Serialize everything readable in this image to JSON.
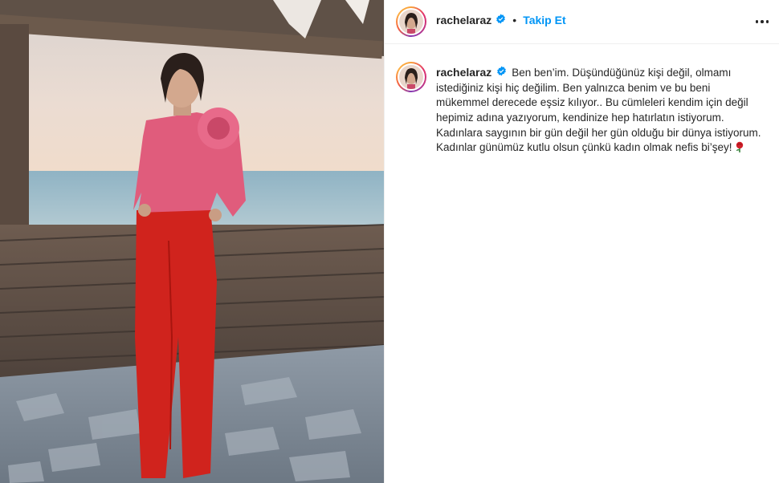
{
  "post": {
    "photo_alt": "post-photo",
    "author": {
      "username": "rachelaraz",
      "verified": true,
      "follow_label": "Takip Et",
      "separator": "•"
    },
    "caption": {
      "username": "rachelaraz",
      "text": "Ben ben’im. Düşündüğünüz kişi değil, olmamı istediğiniz kişi hiç değilim. Ben yalnızca benim ve bu beni mükemmel derecede eşsiz kılıyor.. Bu cümleleri kendim için değil hepimiz adına yazıyorum, kendinize hep hatırlatın istiyorum. Kadınlara saygının bir gün değil her gün olduğu bir dünya istiyorum. Kadınlar günümüz kutlu olsun çünkü kadın olmak nefis bi’şey!",
      "emoji": "rose-icon"
    }
  },
  "colors": {
    "accent": "#0095f6",
    "verified": "#0095f6",
    "text": "#262626",
    "divider": "#efefef"
  }
}
